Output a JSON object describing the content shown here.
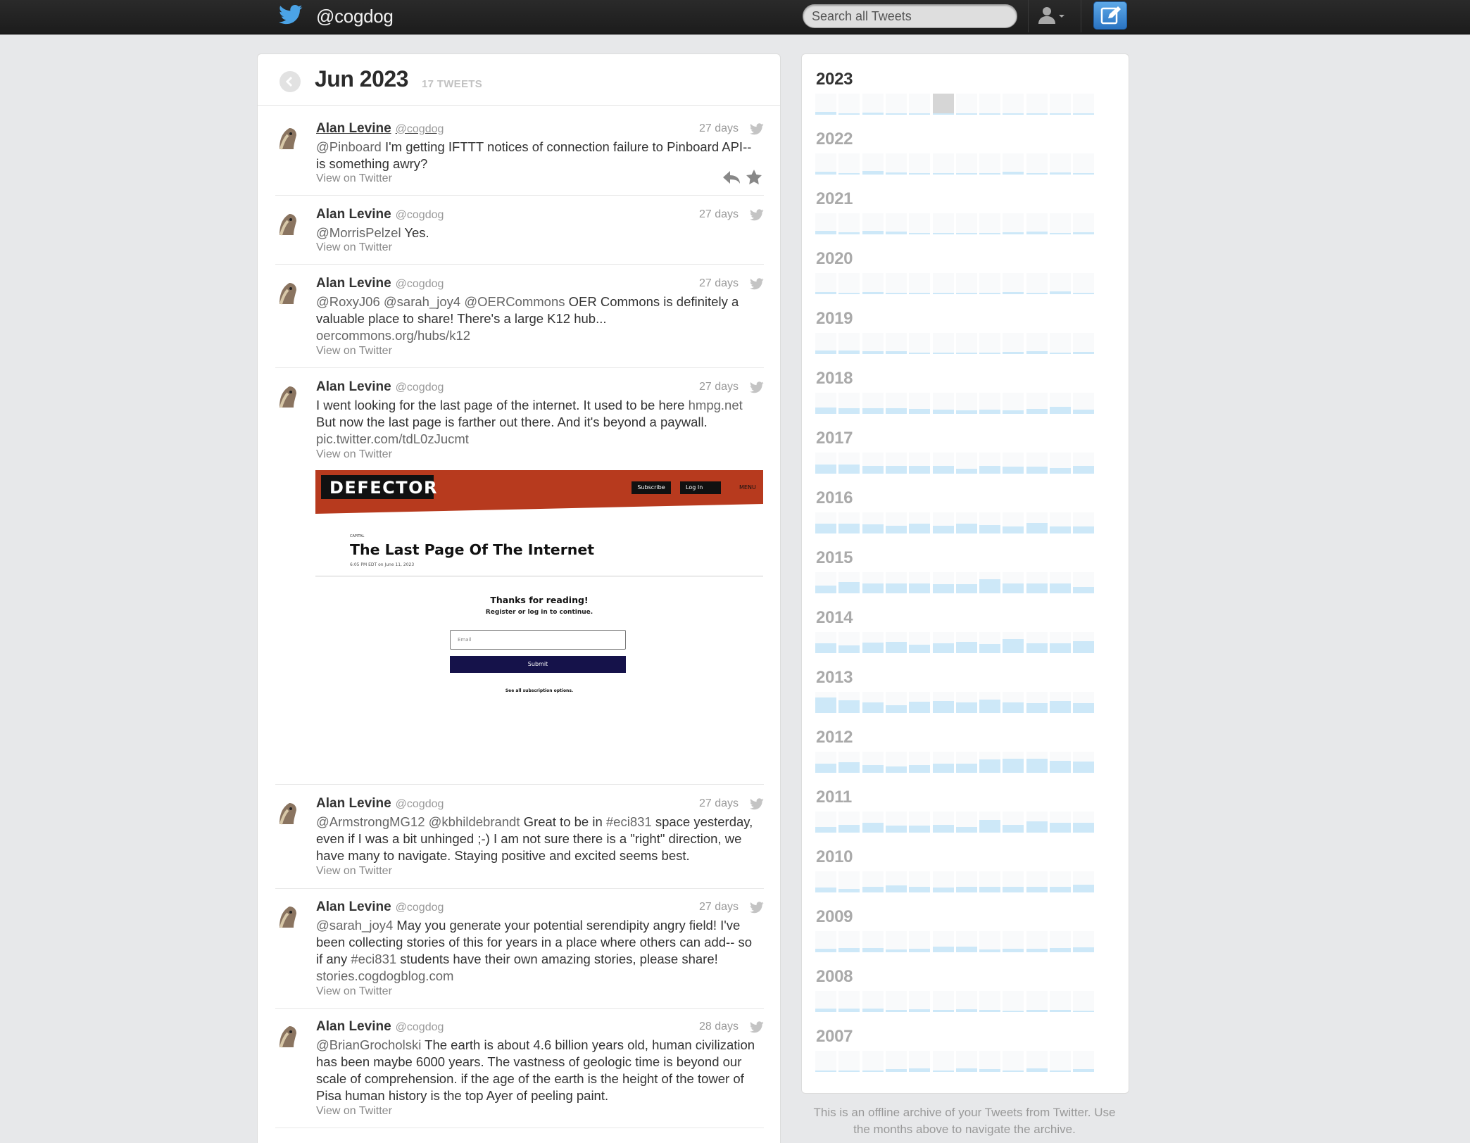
{
  "header": {
    "handle": "@cogdog",
    "search_placeholder": "Search all Tweets"
  },
  "month": {
    "title": "Jun 2023",
    "count": "17 TWEETS"
  },
  "tweets": [
    {
      "name": "Alan Levine",
      "screen_name": "@cogdog",
      "time": "27 days",
      "mention": "@Pinboard",
      "text": " I'm getting IFTTT notices of connection failure to Pinboard API-- is something awry?",
      "view": "View on Twitter"
    },
    {
      "name": "Alan Levine",
      "screen_name": "@cogdog",
      "time": "27 days",
      "mention": "@MorrisPelzel",
      "text": " Yes.",
      "view": "View on Twitter"
    },
    {
      "name": "Alan Levine",
      "screen_name": "@cogdog",
      "time": "27 days",
      "mention": "@RoxyJ06 @sarah_joy4 @OERCommons",
      "text": " OER Commons is definitely a valuable place to share! There's a large K12 hub...",
      "link": "oercommons.org/hubs/k12",
      "view": "View on Twitter"
    },
    {
      "name": "Alan Levine",
      "screen_name": "@cogdog",
      "time": "27 days",
      "text": "I went looking for the last page of the internet. It used to be here ",
      "link_inline": "hmpg.net",
      "text2": " But now the last page is farther out there. And it's beyond a paywall.",
      "link": "pic.twitter.com/tdL0zJucmt",
      "view": "View on Twitter"
    },
    {
      "name": "Alan Levine",
      "screen_name": "@cogdog",
      "time": "27 days",
      "mention": "@ArmstrongMG12 @kbhildebrandt",
      "text": " Great to be in ",
      "link_inline": "#eci831",
      "text2": " space yesterday, even if I was a bit unhinged ;-) I am not sure there is a \"right\" direction, we have many to navigate. Staying positive and excited seems best.",
      "view": "View on Twitter"
    },
    {
      "name": "Alan Levine",
      "screen_name": "@cogdog",
      "time": "27 days",
      "mention": "@sarah_joy4",
      "text": " May you generate your potential serendipity angry field! I've been collecting stories of this for years in a place where others can add-- so if any ",
      "link_inline": "#eci831",
      "text2": " students have their own amazing stories, please share!",
      "link": "stories.cogdogblog.com",
      "view": "View on Twitter"
    },
    {
      "name": "Alan Levine",
      "screen_name": "@cogdog",
      "time": "28 days",
      "mention": "@BrianGrocholski",
      "text": " The earth is about 4.6 billion years old, human civilization has been maybe 6000 years. The vastness of geologic time is beyond our scale of comprehension. if the age of the earth is the height of the tower of Pisa human history is the top Ayer of peeling paint.",
      "view": "View on Twitter"
    }
  ],
  "embed": {
    "logo": "DEFECTOR",
    "subscribe": "Subscribe",
    "login": "Log In",
    "menu": "MENU",
    "category": "CAPITAL",
    "title": "The Last Page Of The Internet",
    "date": "6:05 PM EDT on June 11, 2023",
    "thanks": "Thanks for reading!",
    "register": "Register or log in to continue.",
    "email_placeholder": "Email",
    "submit": "Submit",
    "see_all": "See all subscription options."
  },
  "archive": {
    "years": [
      {
        "year": "2023",
        "current": true,
        "months": [
          0.12,
          0.08,
          0.1,
          0.05,
          0.04,
          0.0,
          0,
          0,
          0,
          0,
          0,
          0
        ],
        "selected_month": 5
      },
      {
        "year": "2022",
        "months": [
          0.12,
          0.08,
          0.15,
          0.1,
          0.06,
          0.05,
          0.07,
          0.04,
          0.12,
          0.08,
          0.1,
          0.06
        ]
      },
      {
        "year": "2021",
        "months": [
          0.15,
          0.1,
          0.18,
          0.12,
          0.08,
          0.06,
          0.07,
          0.08,
          0.1,
          0.12,
          0.08,
          0.1
        ]
      },
      {
        "year": "2020",
        "months": [
          0.1,
          0.08,
          0.1,
          0.06,
          0.05,
          0.06,
          0.05,
          0.08,
          0.1,
          0.08,
          0.12,
          0.08
        ]
      },
      {
        "year": "2019",
        "months": [
          0.18,
          0.15,
          0.12,
          0.12,
          0.06,
          0.08,
          0.05,
          0.08,
          0.1,
          0.12,
          0.08,
          0.1
        ]
      },
      {
        "year": "2018",
        "months": [
          0.3,
          0.28,
          0.28,
          0.25,
          0.22,
          0.2,
          0.15,
          0.2,
          0.18,
          0.22,
          0.32,
          0.2
        ]
      },
      {
        "year": "2017",
        "months": [
          0.42,
          0.42,
          0.38,
          0.35,
          0.35,
          0.35,
          0.22,
          0.38,
          0.32,
          0.32,
          0.25,
          0.35
        ]
      },
      {
        "year": "2016",
        "months": [
          0.48,
          0.45,
          0.42,
          0.38,
          0.45,
          0.35,
          0.45,
          0.4,
          0.32,
          0.5,
          0.32,
          0.32
        ]
      },
      {
        "year": "2015",
        "months": [
          0.38,
          0.52,
          0.48,
          0.45,
          0.45,
          0.42,
          0.42,
          0.68,
          0.45,
          0.45,
          0.45,
          0.3
        ]
      },
      {
        "year": "2014",
        "months": [
          0.45,
          0.38,
          0.5,
          0.52,
          0.4,
          0.48,
          0.52,
          0.42,
          0.68,
          0.48,
          0.48,
          0.58
        ]
      },
      {
        "year": "2013",
        "months": [
          0.72,
          0.6,
          0.5,
          0.38,
          0.52,
          0.58,
          0.5,
          0.62,
          0.5,
          0.48,
          0.55,
          0.48
        ]
      },
      {
        "year": "2012",
        "months": [
          0.42,
          0.5,
          0.38,
          0.3,
          0.35,
          0.42,
          0.42,
          0.62,
          0.68,
          0.65,
          0.58,
          0.52
        ]
      },
      {
        "year": "2011",
        "months": [
          0.28,
          0.38,
          0.45,
          0.32,
          0.32,
          0.35,
          0.25,
          0.6,
          0.38,
          0.52,
          0.45,
          0.48
        ]
      },
      {
        "year": "2010",
        "months": [
          0.22,
          0.15,
          0.28,
          0.32,
          0.28,
          0.22,
          0.28,
          0.28,
          0.25,
          0.28,
          0.28,
          0.35
        ]
      },
      {
        "year": "2009",
        "months": [
          0.15,
          0.2,
          0.2,
          0.12,
          0.18,
          0.25,
          0.25,
          0.12,
          0.18,
          0.18,
          0.2,
          0.22
        ]
      },
      {
        "year": "2008",
        "months": [
          0.15,
          0.18,
          0.18,
          0.1,
          0.12,
          0.1,
          0.12,
          0.1,
          0.08,
          0.1,
          0.1,
          0.08
        ]
      },
      {
        "year": "2007",
        "months": [
          0.0,
          0.05,
          0.05,
          0.12,
          0.15,
          0.05,
          0.15,
          0.12,
          0.05,
          0.15,
          0.08,
          0.12
        ]
      }
    ],
    "note": "This is an offline archive of your Tweets from Twitter. Use the months above to navigate the archive."
  },
  "colors": {
    "link": "#666666",
    "bar_fill": "#cde8f8",
    "topbar": "#222222",
    "compose": "#3b8ad8"
  }
}
